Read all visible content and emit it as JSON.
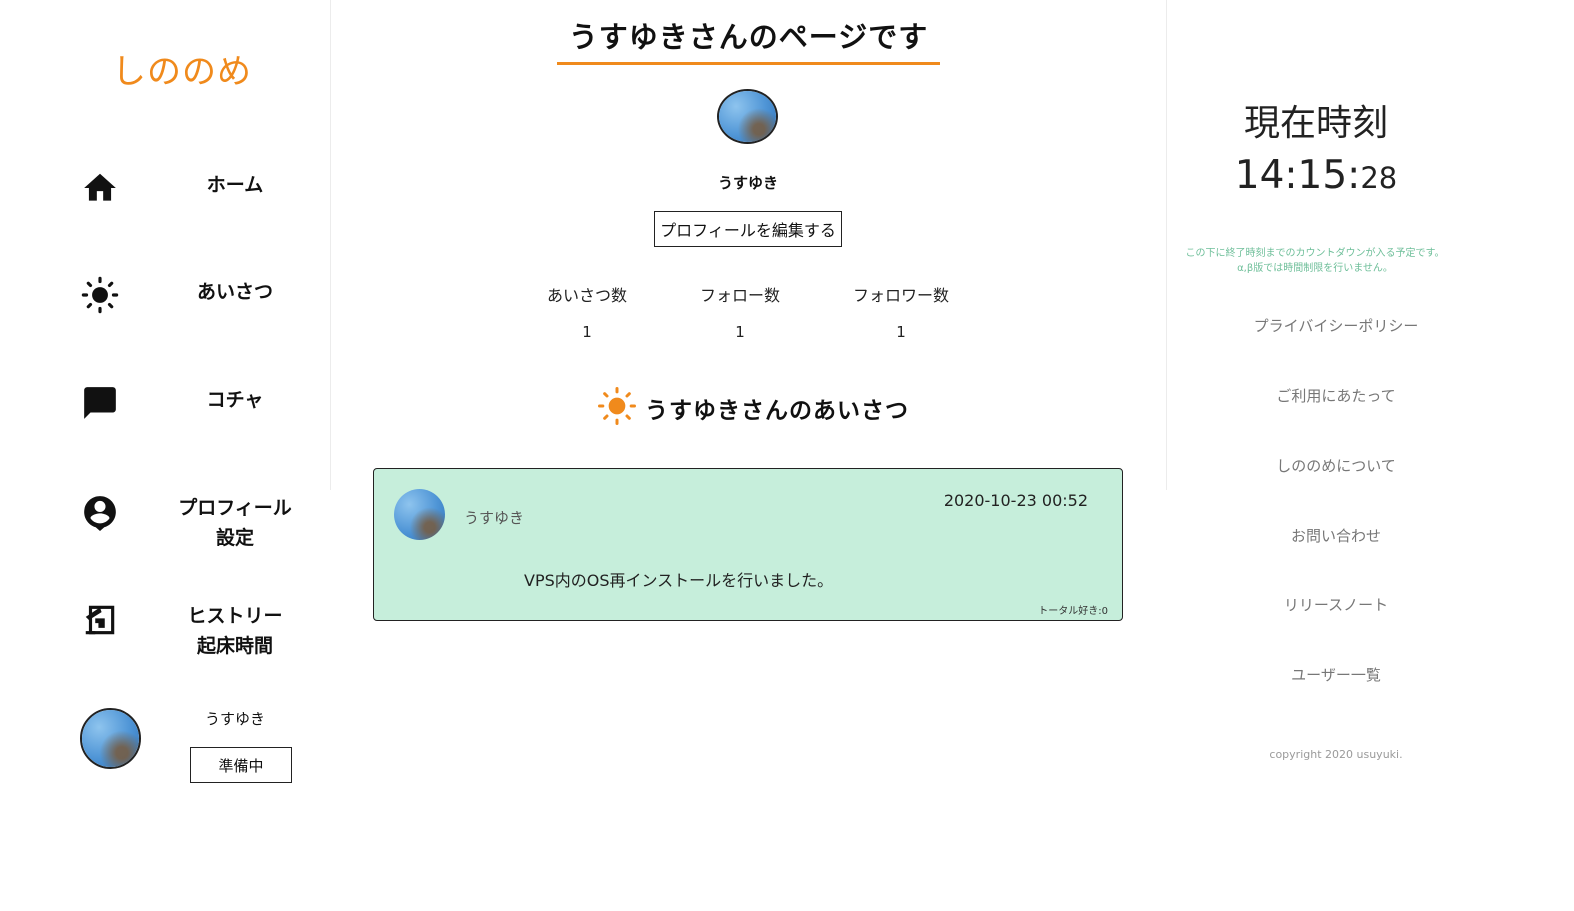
{
  "app": {
    "logo_text": "しののめ",
    "accent_color": "#f08a1c"
  },
  "sidebar": {
    "items": [
      {
        "label": "ホーム",
        "icon": "home-icon"
      },
      {
        "label": "あいさつ",
        "icon": "sun-icon"
      },
      {
        "label": "コチャ",
        "icon": "chat-icon"
      },
      {
        "label_line1": "プロフィール",
        "label_line2": "設定",
        "icon": "account-icon"
      },
      {
        "label_line1": "ヒストリー",
        "label_line2": "起床時間",
        "icon": "history-icon"
      }
    ],
    "user": {
      "name": "うすゆき",
      "button_label": "準備中"
    }
  },
  "main": {
    "title": "うすゆきさんのページです",
    "profile_name": "うすゆき",
    "edit_button": "プロフィールを編集する",
    "stats": [
      {
        "label": "あいさつ数",
        "value": "1"
      },
      {
        "label": "フォロー数",
        "value": "1"
      },
      {
        "label": "フォロワー数",
        "value": "1"
      }
    ],
    "section_heading": "うすゆきさんのあいさつ",
    "posts": [
      {
        "user": "うすゆき",
        "timestamp": "2020-10-23 00:52",
        "body": "VPS内のOS再インストールを行いました。",
        "likes": "トータル好き:0",
        "background": "#c6eedb"
      }
    ]
  },
  "right": {
    "clock_title": "現在時刻",
    "clock_hm": "14:15:",
    "clock_s": "28",
    "notice_line1": "この下に終了時刻までのカウントダウンが入る予定です。",
    "notice_line2": "α,β版では時間制限を行いません。",
    "links": [
      "プライバイシーポリシー",
      "ご利用にあたって",
      "しののめについて",
      "お問い合わせ",
      "リリースノート",
      "ユーザー一覧"
    ],
    "copyright": "copyright 2020 usuyuki."
  }
}
